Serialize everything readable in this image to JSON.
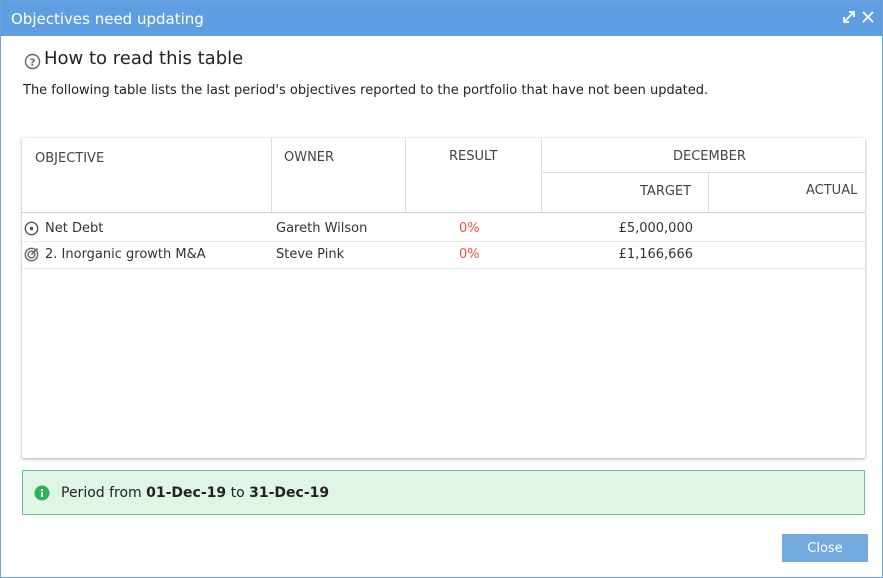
{
  "dialog": {
    "title": "Objectives need updating",
    "help_title": "How to read this table",
    "description": "The following table lists the last period's objectives reported to the portfolio that have not been updated."
  },
  "table": {
    "headers": {
      "objective": "OBJECTIVE",
      "owner": "OWNER",
      "result": "RESULT",
      "period": "DECEMBER",
      "target": "TARGET",
      "actual": "ACTUAL"
    },
    "rows": [
      {
        "icon": "circle-dot-icon",
        "objective": "Net Debt",
        "owner": "Gareth Wilson",
        "result": "0%",
        "target": "£5,000,000",
        "actual": ""
      },
      {
        "icon": "target-icon",
        "objective": "2. Inorganic growth M&A",
        "owner": "Steve Pink",
        "result": "0%",
        "target": "£1,166,666",
        "actual": ""
      }
    ]
  },
  "period": {
    "prefix": "Period from",
    "from": "01-Dec-19",
    "middle": "to",
    "to": "31-Dec-19"
  },
  "buttons": {
    "close": "Close"
  },
  "colors": {
    "titlebar": "#5f9ee0",
    "result_red": "#e4534b",
    "info_green": "#2fb15a",
    "period_bg": "#dff5e6",
    "button": "#73abe0"
  }
}
